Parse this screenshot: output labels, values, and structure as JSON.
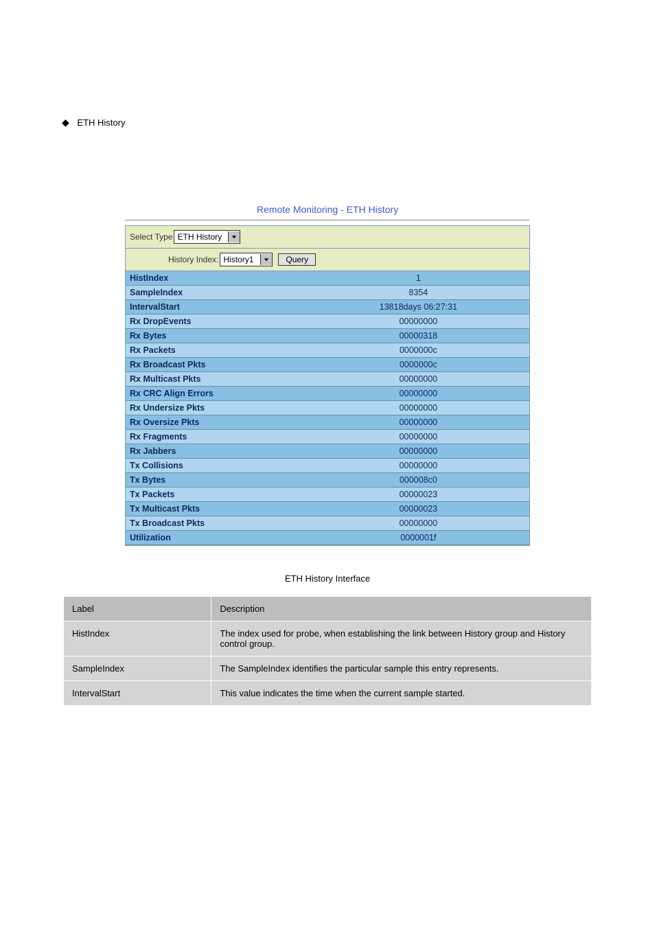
{
  "bullet": "ETH History",
  "panel_title": "Remote Monitoring - ETH History",
  "select_type_label": "Select Type",
  "select_type_value": "ETH History",
  "history_index_label": "History Index:",
  "history_index_value": "History1",
  "query_button": "Query",
  "table_rows": [
    {
      "k": "HistIndex",
      "v": "1"
    },
    {
      "k": "SampleIndex",
      "v": "8354"
    },
    {
      "k": "IntervalStart",
      "v": "13818days 06:27:31"
    },
    {
      "k": "Rx DropEvents",
      "v": "00000000"
    },
    {
      "k": "Rx Bytes",
      "v": "00000318"
    },
    {
      "k": "Rx Packets",
      "v": "0000000c"
    },
    {
      "k": "Rx Broadcast Pkts",
      "v": "0000000c"
    },
    {
      "k": "Rx Multicast Pkts",
      "v": "00000000"
    },
    {
      "k": "Rx CRC Align Errors",
      "v": "00000000"
    },
    {
      "k": "Rx Undersize Pkts",
      "v": "00000000"
    },
    {
      "k": "Rx Oversize Pkts",
      "v": "00000000"
    },
    {
      "k": "Rx Fragments",
      "v": "00000000"
    },
    {
      "k": "Rx Jabbers",
      "v": "00000000"
    },
    {
      "k": "Tx Collisions",
      "v": "00000000"
    },
    {
      "k": "Tx Bytes",
      "v": "000008c0"
    },
    {
      "k": "Tx Packets",
      "v": "00000023"
    },
    {
      "k": "Tx Multicast Pkts",
      "v": "00000023"
    },
    {
      "k": "Tx Broadcast Pkts",
      "v": "00000000"
    },
    {
      "k": "Utilization",
      "v": "0000001f"
    }
  ],
  "caption": "ETH History Interface",
  "desc_header": {
    "c1": "Label",
    "c2": "Description"
  },
  "desc_rows": [
    {
      "c1": "HistIndex",
      "c2": "The index used for probe, when establishing the link between History group and History control group."
    },
    {
      "c1": "SampleIndex",
      "c2": "The SampleIndex identifies the particular sample this entry represents."
    },
    {
      "c1": "IntervalStart",
      "c2": "This value indicates the time when the current sample started."
    }
  ]
}
